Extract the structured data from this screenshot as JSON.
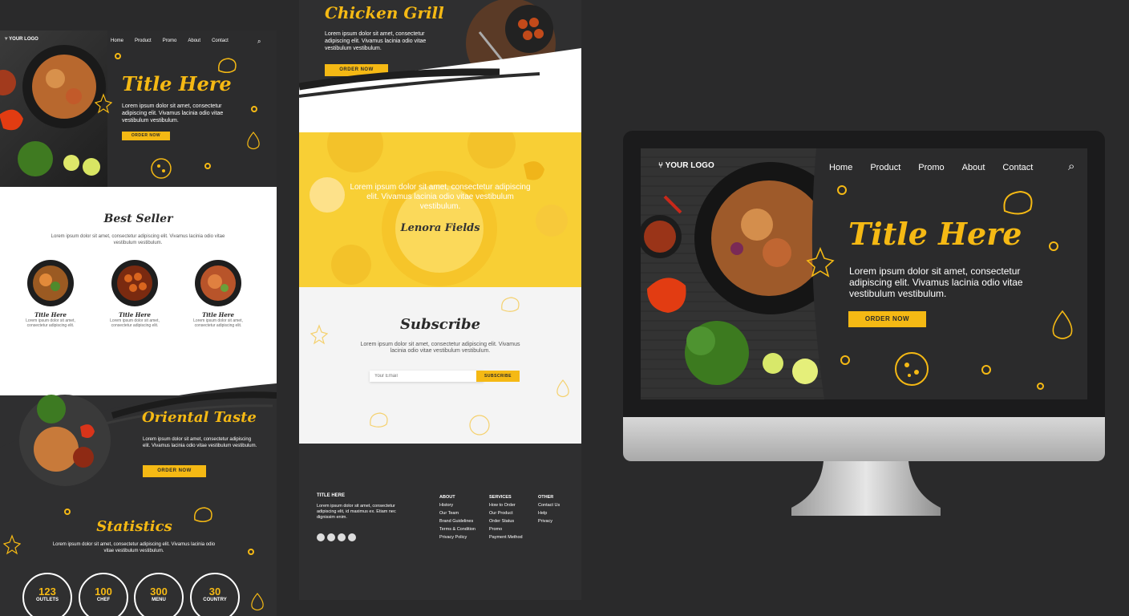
{
  "left": {
    "nav": {
      "logo": "YOUR LOGO",
      "items": [
        "Home",
        "Product",
        "Promo",
        "About",
        "Contact"
      ]
    },
    "hero": {
      "title": "Title Here",
      "text": "Lorem ipsum dolor sit amet, consectetur adipiscing elit. Vivamus lacinia odio vitae vestibulum vestibulum.",
      "button": "ORDER NOW"
    },
    "best_seller": {
      "title": "Best Seller",
      "text": "Lorem ipsum dolor sit amet, consectetur adipiscing elit. Vivamus lacinia odio vitae vestibulum vestibulum.",
      "items": [
        {
          "title": "Title Here",
          "text": "Lorem ipsum dolor sit amet, consectetur adipiscing elit."
        },
        {
          "title": "Title Here",
          "text": "Lorem ipsum dolor sit amet, consectetur adipiscing elit."
        },
        {
          "title": "Title Here",
          "text": "Lorem ipsum dolor sit amet, consectetur adipiscing elit."
        }
      ]
    },
    "oriental": {
      "title": "Oriental Taste",
      "text": "Lorem ipsum dolor sit amet, consectetur adipiscing elit. Vivamus lacinia odio vitae vestibulum vestibulum.",
      "button": "ORDER NOW"
    },
    "statistics": {
      "title": "Statistics",
      "text": "Lorem ipsum dolor sit amet, consectetur adipiscing elit. Vivamus lacinia odio vitae vestibulum vestibulum.",
      "stats": [
        {
          "value": "123",
          "label": "OUTLETS"
        },
        {
          "value": "100",
          "label": "CHEF"
        },
        {
          "value": "300",
          "label": "MENU"
        },
        {
          "value": "30",
          "label": "COUNTRY"
        }
      ]
    }
  },
  "middle": {
    "chicken": {
      "title": "Chicken Grill",
      "text": "Lorem ipsum dolor sit amet, consectetur adipiscing elit. Vivamus lacinia odio vitae vestibulum vestibulum.",
      "button": "ORDER NOW"
    },
    "testimonial": {
      "text": "Lorem ipsum dolor sit amet, consectetur adipiscing elit. Vivamus lacinia odio vitae vestibulum vestibulum.",
      "name": "Lenora Fields"
    },
    "subscribe": {
      "title": "Subscribe",
      "text": "Lorem ipsum dolor sit amet, consectetur adipiscing elit. Vivamus lacinia odio vitae vestibulum vestibulum.",
      "placeholder": "Your Email",
      "button": "SUBSCRIBE"
    },
    "footer": {
      "title": "TITLE HERE",
      "text": "Lorem ipsum dolor sit amet, consectetur adipiscing elit, id maximus ex. Etiam nec dignissim enim.",
      "columns": [
        {
          "heading": "ABOUT",
          "links": [
            "History",
            "Our Team",
            "Brand Guidelines",
            "Terms & Condition",
            "Privacy Policy"
          ]
        },
        {
          "heading": "SERVICES",
          "links": [
            "How to Order",
            "Our Product",
            "Order Status",
            "Promo",
            "Payment Method"
          ]
        },
        {
          "heading": "OTHER",
          "links": [
            "Contact Us",
            "Help",
            "Privacy"
          ]
        }
      ]
    }
  },
  "monitor": {
    "nav": {
      "logo": "YOUR LOGO",
      "items": [
        "Home",
        "Product",
        "Promo",
        "About",
        "Contact"
      ]
    },
    "hero": {
      "title": "Title Here",
      "text": "Lorem ipsum dolor sit amet, consectetur adipiscing elit. Vivamus lacinia odio vitae vestibulum vestibulum.",
      "button": "ORDER NOW"
    }
  },
  "colors": {
    "accent": "#f5b914",
    "dark": "#2b2b2c",
    "yellow_band": "#f8cf35"
  }
}
